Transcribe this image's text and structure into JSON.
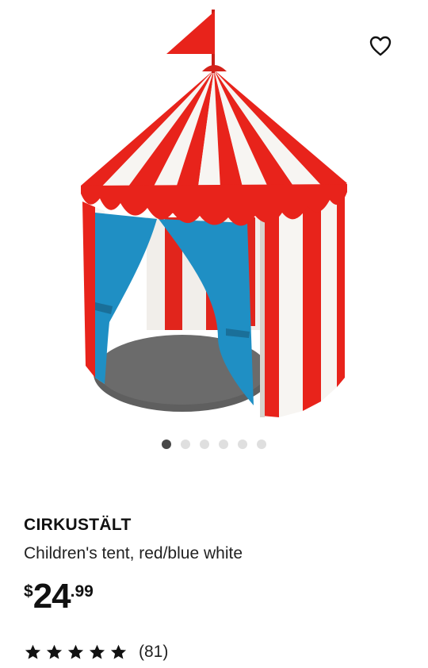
{
  "product": {
    "name": "CIRKUSTÄLT",
    "description": "Children's tent, red/blue white",
    "image_subject": "red and white striped circus play tent with blue curtains",
    "price": {
      "currency": "$",
      "integer": "24",
      "decimal": ".99"
    },
    "rating": {
      "stars": 5,
      "max_stars": 5,
      "count_label": "(81)"
    }
  },
  "gallery": {
    "total_images": 6,
    "active_index": 0
  },
  "icons": {
    "favorite": "heart-outline-icon",
    "rating": "star-icon"
  },
  "colors": {
    "tent_red": "#e8231b",
    "tent_white": "#f7f5f2",
    "tent_blue": "#1f8fc4",
    "floor_grey": "#626262",
    "active_dot": "#484848",
    "inactive_dot": "#dfdfdf"
  }
}
